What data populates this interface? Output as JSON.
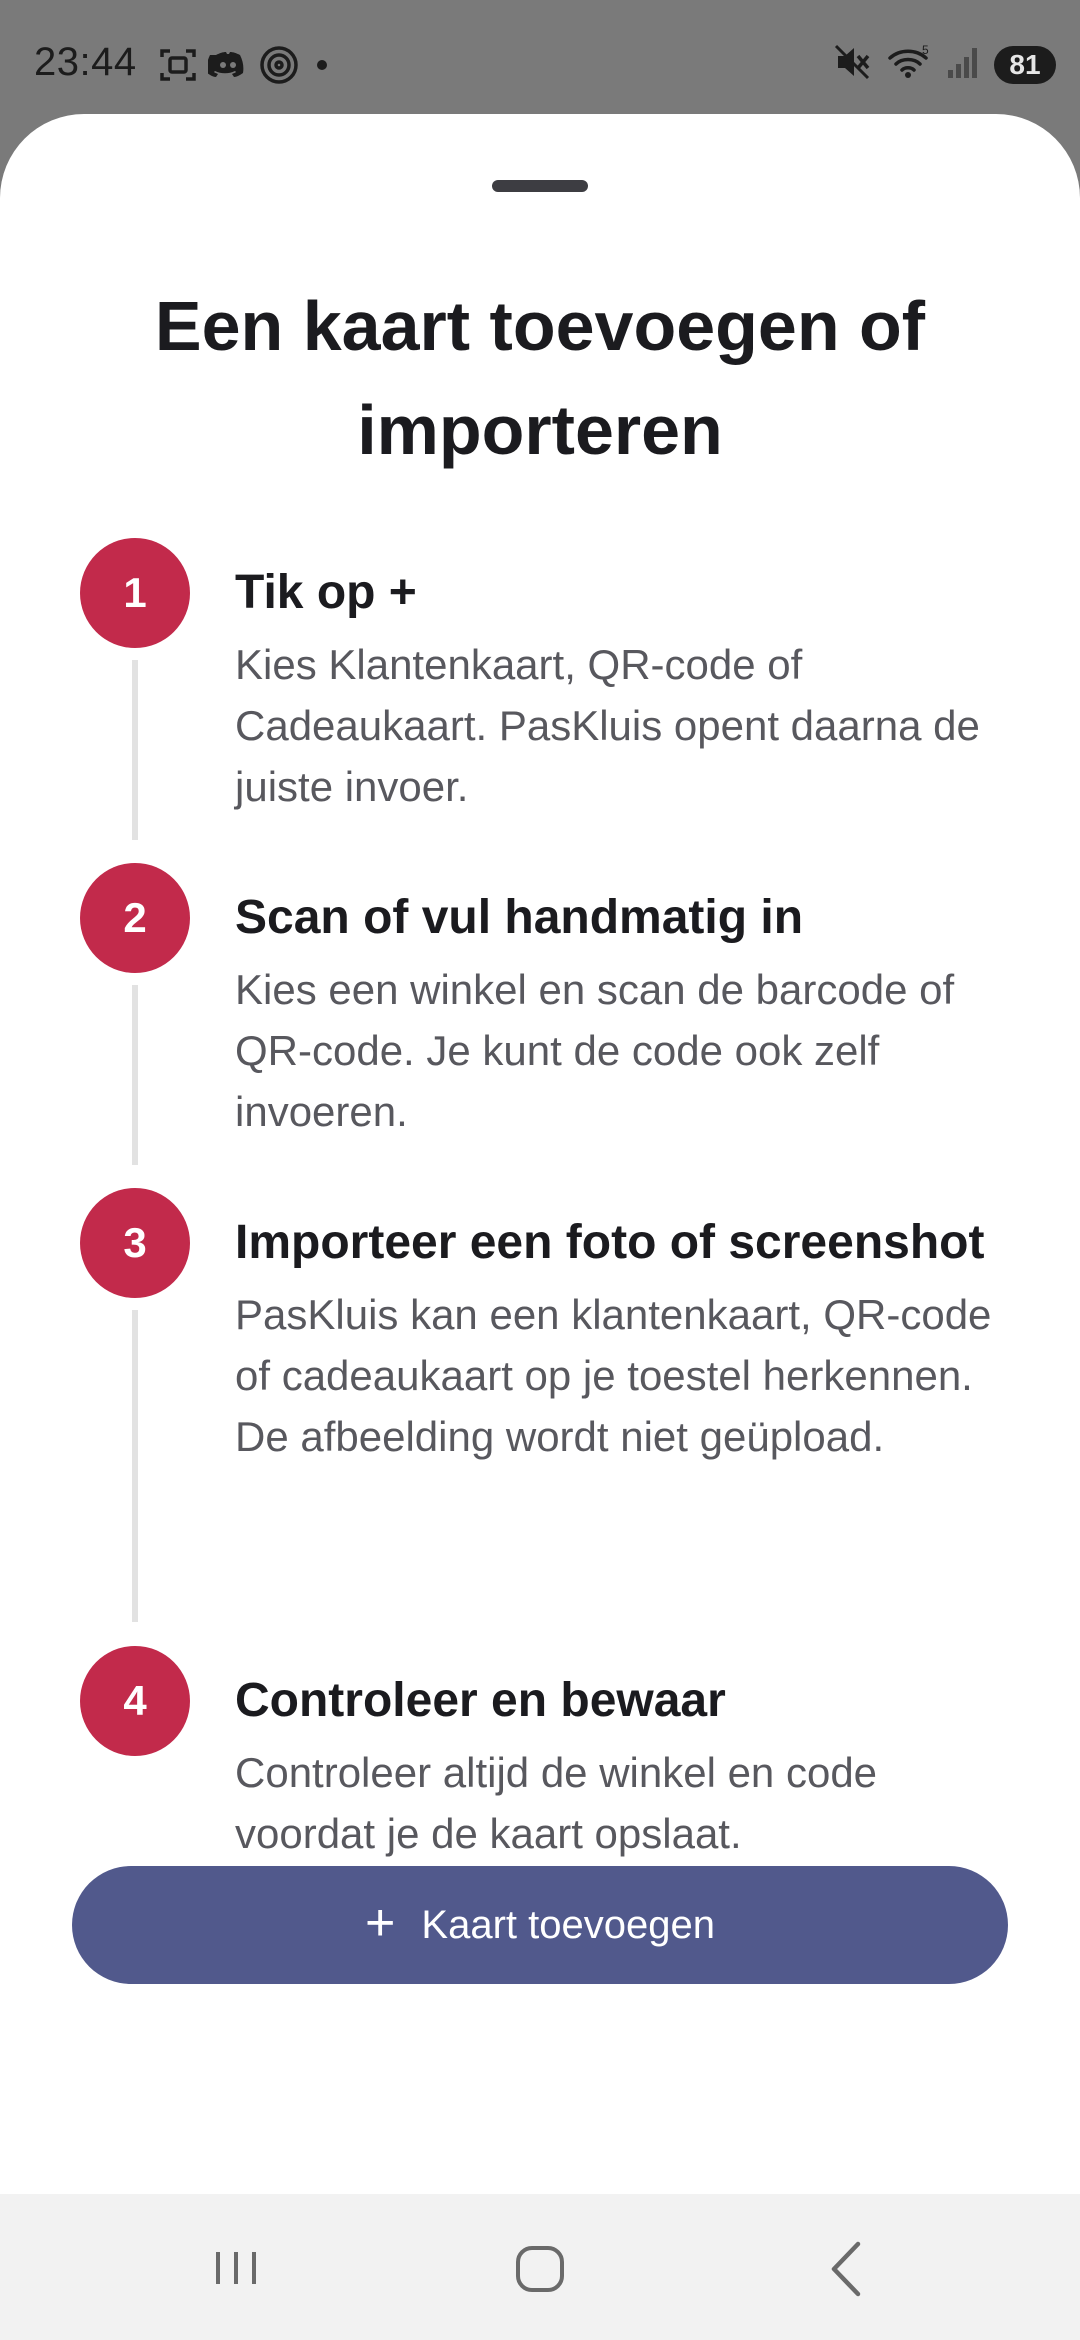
{
  "status_bar": {
    "time": "23:44",
    "battery": "81",
    "icons": [
      "screenshot-icon",
      "discord-icon",
      "hotspot-icon",
      "dot-icon",
      "mute-icon",
      "wifi-icon",
      "signal-icon"
    ]
  },
  "sheet": {
    "title": "Een kaart toevoegen of importeren",
    "steps": [
      {
        "number": "1",
        "title": "Tik op +",
        "description": "Kies Klantenkaart, QR-code of Cadeaukaart. PasKluis opent daarna de juiste invoer."
      },
      {
        "number": "2",
        "title": "Scan of vul handmatig in",
        "description": "Kies een winkel en scan de barcode of QR-code. Je kunt de code ook zelf invoeren."
      },
      {
        "number": "3",
        "title": "Importeer een foto of screenshot",
        "description": "PasKluis kan een klantenkaart, QR-code of cadeaukaart op je toestel herkennen. De afbeelding wordt niet geüpload."
      },
      {
        "number": "4",
        "title": "Controleer en bewaar",
        "description": "Controleer altijd de winkel en code voordat je de kaart opslaat."
      }
    ],
    "cta": {
      "icon": "+",
      "label": "Kaart toevoegen"
    }
  },
  "colors": {
    "accent_badge": "#c22a4b",
    "primary_button": "#51598c",
    "status_bar_bg": "#7a7a7a"
  },
  "nav_bar": {
    "buttons": [
      "recents-icon",
      "home-icon",
      "back-icon"
    ]
  }
}
